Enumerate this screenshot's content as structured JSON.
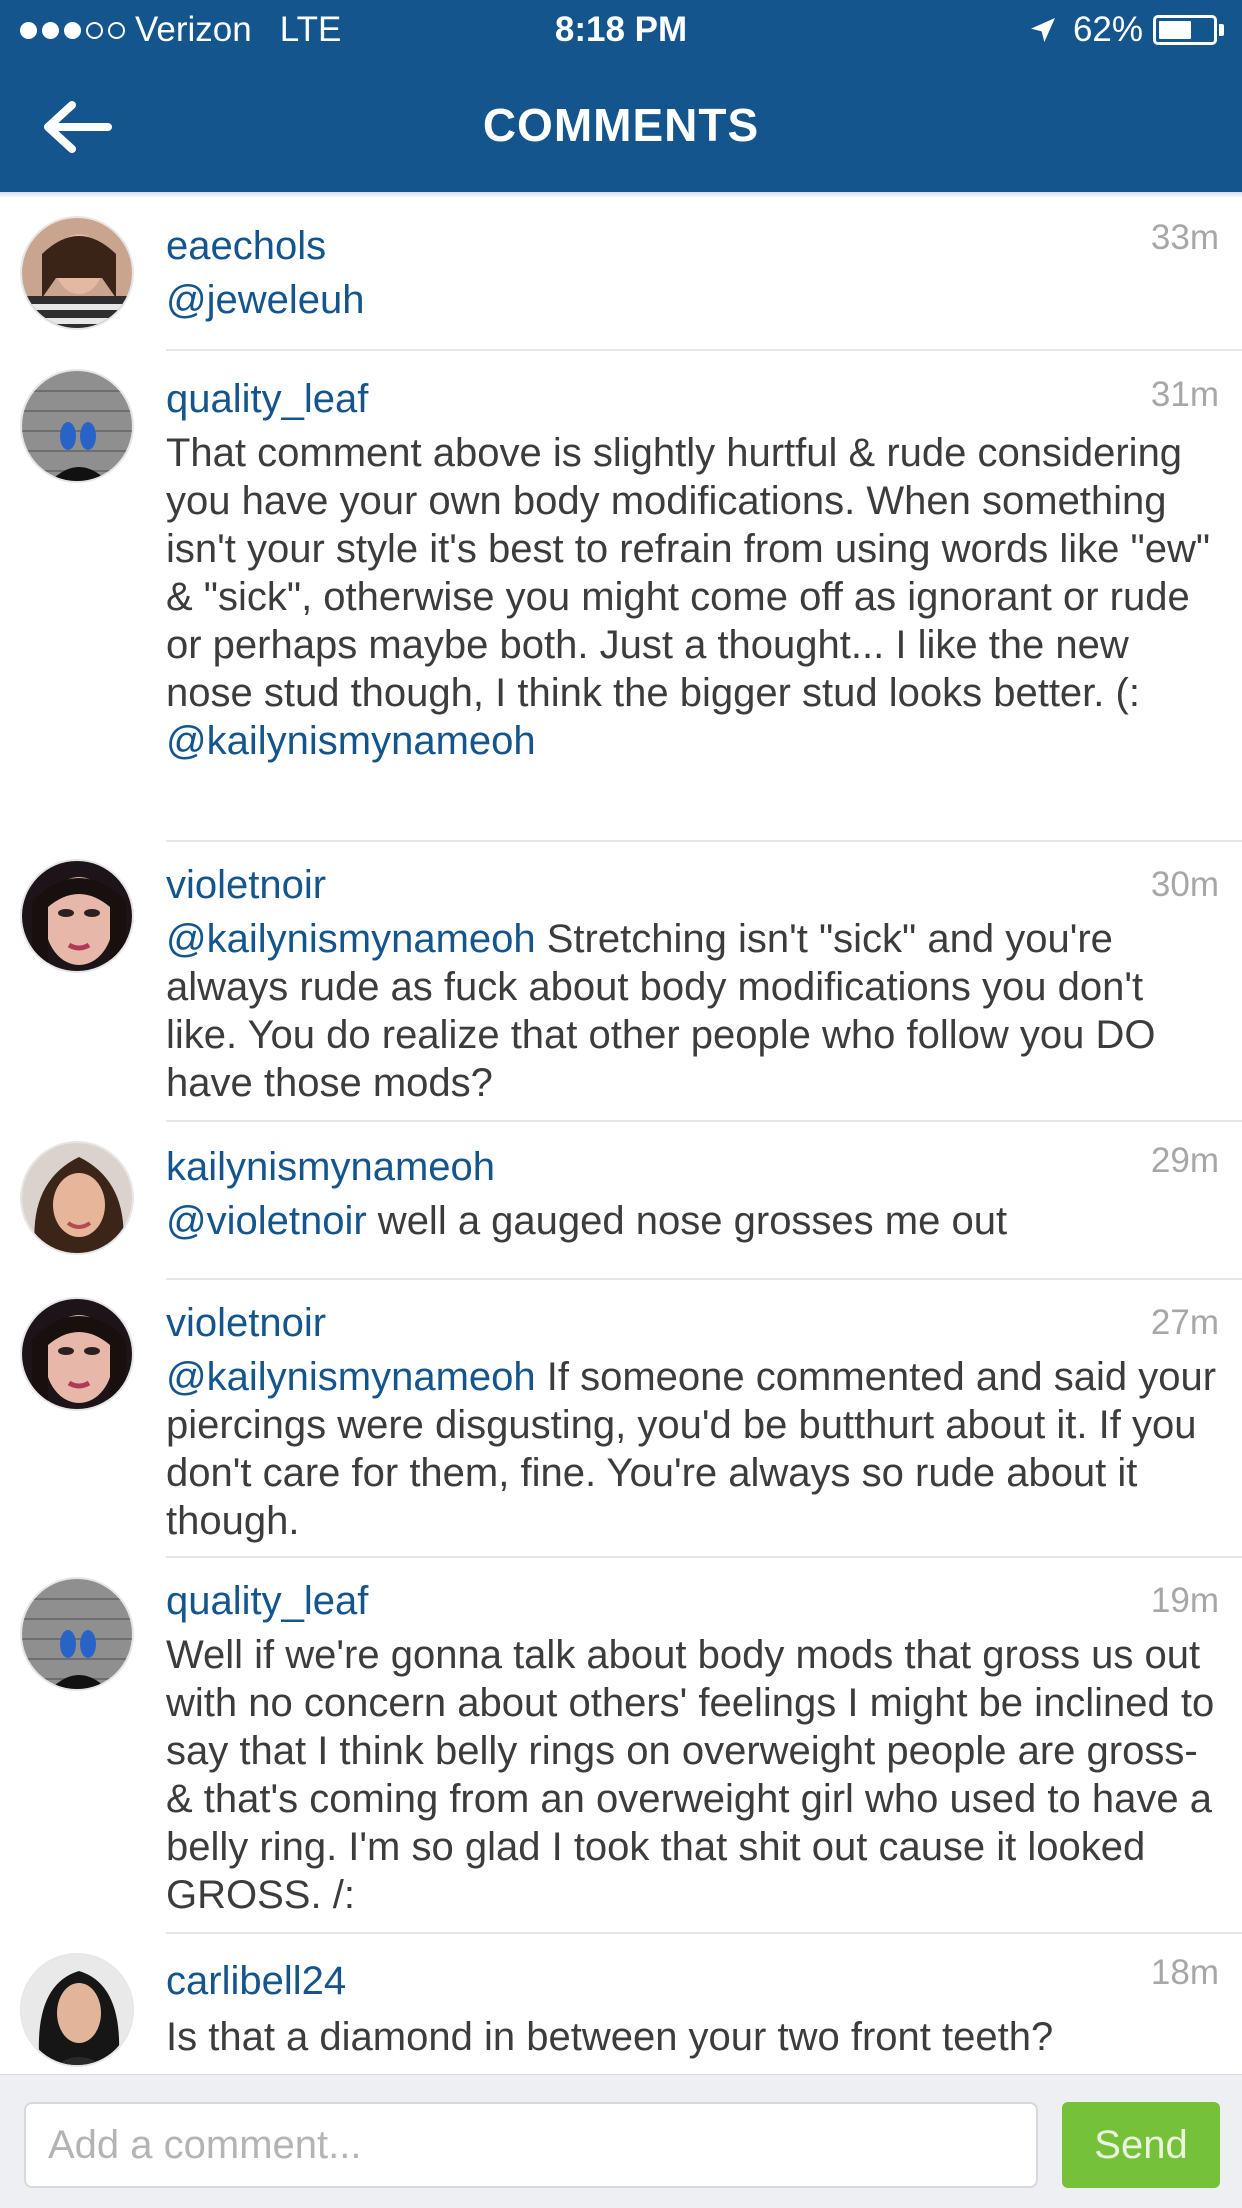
{
  "status_bar": {
    "carrier": "Verizon",
    "network": "LTE",
    "time": "8:18 PM",
    "battery_percent": "62%",
    "battery_level": 0.62,
    "signal_dots_filled": 3,
    "signal_dots_total": 5
  },
  "header": {
    "title": "COMMENTS",
    "back_icon": "back-arrow-icon"
  },
  "comments": [
    {
      "username": "eaechols",
      "time": "33m",
      "segments": [
        {
          "text": "@jeweleuh",
          "mention": true
        }
      ]
    },
    {
      "username": "quality_leaf",
      "time": "31m",
      "segments": [
        {
          "text": "That comment above is slightly hurtful & rude considering you have your own body modifications. When something isn't your style it's best to refrain from using words like \"ew\" & \"sick\", otherwise you might come off as ignorant or rude or perhaps maybe both. Just a thought... I like the new nose stud though, I think the bigger stud looks better. (: ",
          "mention": false
        },
        {
          "text": "@kailynismynameoh",
          "mention": true
        }
      ]
    },
    {
      "username": "violetnoir",
      "time": "30m",
      "segments": [
        {
          "text": "@kailynismynameoh",
          "mention": true
        },
        {
          "text": " Stretching isn't \"sick\" and you're always rude as fuck about body modifications you don't like. You do realize that other people who follow you DO have those mods?",
          "mention": false
        }
      ]
    },
    {
      "username": "kailynismynameoh",
      "time": "29m",
      "segments": [
        {
          "text": "@violetnoir",
          "mention": true
        },
        {
          "text": " well a gauged nose grosses me out",
          "mention": false
        }
      ]
    },
    {
      "username": "violetnoir",
      "time": "27m",
      "segments": [
        {
          "text": "@kailynismynameoh",
          "mention": true
        },
        {
          "text": " If someone commented and said your piercings were disgusting, you'd be butthurt about it. If you don't care for them, fine. You're always so rude about it though.",
          "mention": false
        }
      ]
    },
    {
      "username": "quality_leaf",
      "time": "19m",
      "segments": [
        {
          "text": "Well if we're gonna talk about body mods that gross us out with no concern about others' feelings I might be inclined to say that I think belly rings on overweight people are gross- & that's coming from an overweight girl who used to have a belly ring. I'm so glad I took that shit out cause it looked GROSS. /:",
          "mention": false
        }
      ]
    },
    {
      "username": "carlibell24",
      "time": "18m",
      "segments": [
        {
          "text": "Is that a diamond in between your two front teeth?",
          "mention": false
        }
      ]
    }
  ],
  "composer": {
    "placeholder": "Add a comment...",
    "send_label": "Send"
  },
  "colors": {
    "brand": "#13558c",
    "send": "#76c13a",
    "timestamp": "#a7a7a7"
  }
}
